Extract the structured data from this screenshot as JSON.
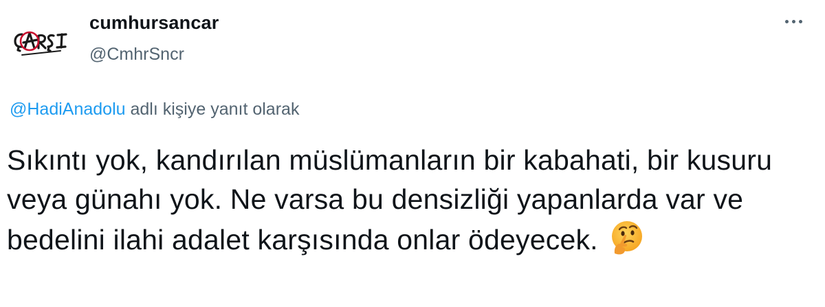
{
  "tweet": {
    "author": {
      "display_name": "cumhursancar",
      "handle": "@CmhrSncr",
      "avatar_text": "ÇARŞI"
    },
    "reply": {
      "mention": "@HadiAnadolu",
      "suffix": " adlı kişiye yanıt olarak"
    },
    "text": "Sıkıntı yok, kandırılan müslümanların bir kabahati, bir kusuru veya günahı yok. Ne varsa bu densizliği yapanlarda var ve bedelini ilahi adalet karşısında onlar ödeyecek.",
    "emoji": "thinking-face-emoji",
    "more_icon": "more-options-icon"
  },
  "colors": {
    "text_primary": "#0f1419",
    "text_secondary": "#536471",
    "link": "#1d9bf0"
  }
}
